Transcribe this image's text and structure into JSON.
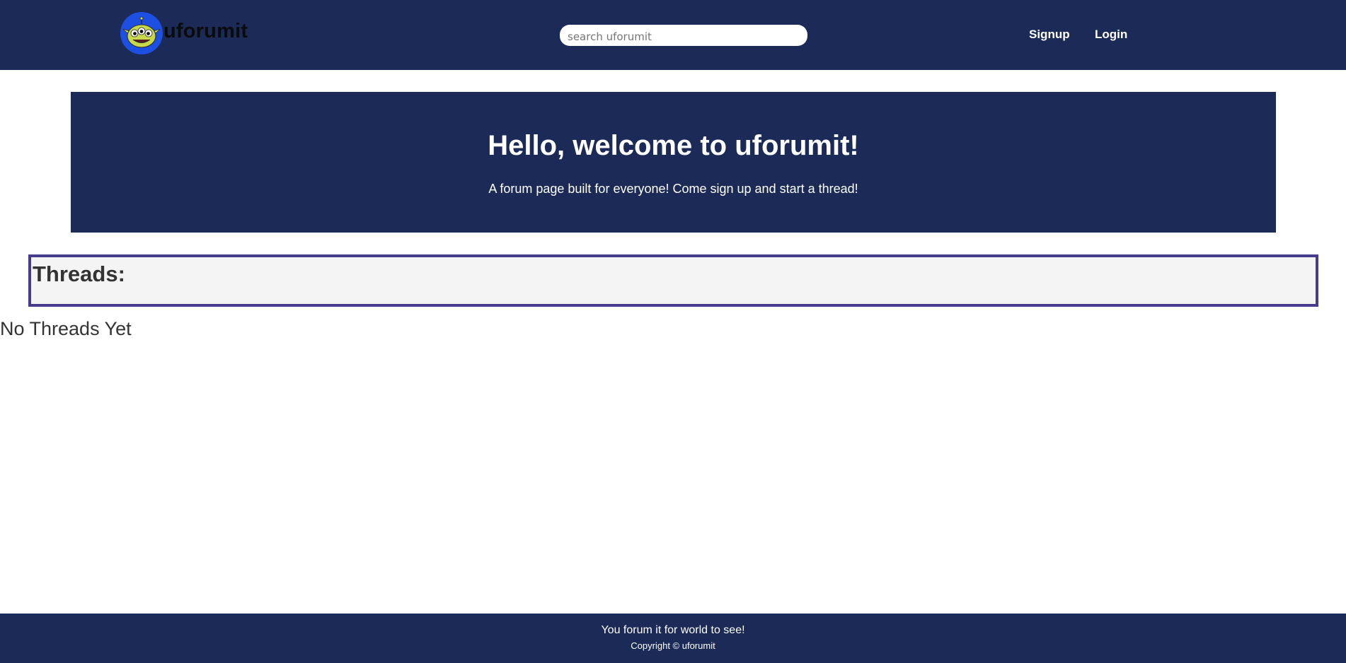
{
  "navbar": {
    "brand_name": "uforumit",
    "logo_icon": "alien-logo-icon",
    "search": {
      "placeholder": "search uforumit",
      "value": ""
    },
    "links": [
      {
        "label": "Signup"
      },
      {
        "label": "Login"
      }
    ]
  },
  "hero": {
    "title": "Hello, welcome to uforumit!",
    "subtitle": "A forum page built for everyone! Come sign up and start a thread!"
  },
  "threads": {
    "heading": "Threads:",
    "empty_message": "No Threads Yet"
  },
  "footer": {
    "tagline": "You forum it for world to see!",
    "copyright": "Copyright © uforumit"
  },
  "colors": {
    "navy": "#1b2a57",
    "threads_border": "#473c8b",
    "threads_bg": "#f4f4f4",
    "logo_blue": "#1e4fe3",
    "alien_green": "#c8d84a"
  }
}
